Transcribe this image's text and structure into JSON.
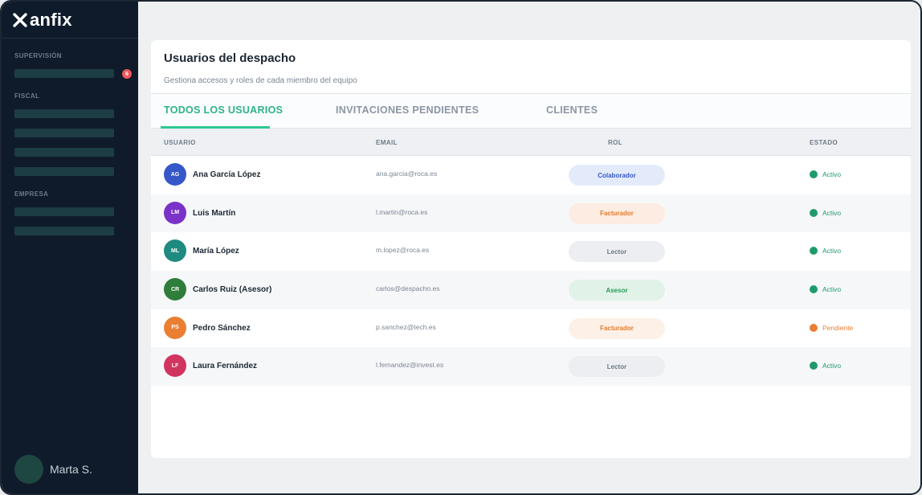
{
  "brand": {
    "name": "anfix"
  },
  "sidebar": {
    "sections": [
      "SUPERVISIÓN",
      "FISCAL",
      "EMPRESA"
    ],
    "badge_count": "6",
    "user_name": "Marta S."
  },
  "card": {
    "title": "Usuarios del despacho",
    "subtitle": "Gestiona accesos y roles de cada miembro del equipo"
  },
  "tabs": [
    {
      "label": "TODOS LOS USUARIOS",
      "active": true
    },
    {
      "label": "INVITACIONES PENDIENTES",
      "active": false
    },
    {
      "label": "CLIENTES",
      "active": false
    }
  ],
  "table": {
    "headers": [
      "USUARIO",
      "EMAIL",
      "ROL",
      "ESTADO"
    ],
    "rows": [
      {
        "initials": "AG",
        "name": "Ana García López",
        "email": "ana.garcia@roca.es",
        "role": "Colaborador",
        "status": "Activo",
        "avatar_color": "#3557c8",
        "role_bg": "#e3ebfb",
        "role_color": "#3557c8",
        "status_color": "#1f9a6c"
      },
      {
        "initials": "LM",
        "name": "Luis Martín",
        "email": "l.martin@roca.es",
        "role": "Facturador",
        "status": "Activo",
        "avatar_color": "#7a32c8",
        "role_bg": "#fdece1",
        "role_color": "#e07a2c",
        "status_color": "#1f9a6c"
      },
      {
        "initials": "ML",
        "name": "María López",
        "email": "m.lopez@roca.es",
        "role": "Lector",
        "status": "Activo",
        "avatar_color": "#1f8a80",
        "role_bg": "#eceef1",
        "role_color": "#6d7886",
        "status_color": "#1f9a6c"
      },
      {
        "initials": "CR",
        "name": "Carlos Ruiz (Asesor)",
        "email": "carlos@despacho.es",
        "role": "Asesor",
        "status": "Activo",
        "avatar_color": "#2e7d3a",
        "role_bg": "#e1f3e8",
        "role_color": "#2a9a5a",
        "status_color": "#1f9a6c"
      },
      {
        "initials": "PS",
        "name": "Pedro Sánchez",
        "email": "p.sanchez@tech.es",
        "role": "Facturador",
        "status": "Pendiente",
        "avatar_color": "#ea7f33",
        "role_bg": "#fdf1e7",
        "role_color": "#e07a2c",
        "status_color": "#ea7f33"
      },
      {
        "initials": "LF",
        "name": "Laura Fernández",
        "email": "l.fernandez@invest.es",
        "role": "Lector",
        "status": "Activo",
        "avatar_color": "#d0345f",
        "role_bg": "#eceef1",
        "role_color": "#6d7886",
        "status_color": "#1f9a6c"
      }
    ]
  }
}
